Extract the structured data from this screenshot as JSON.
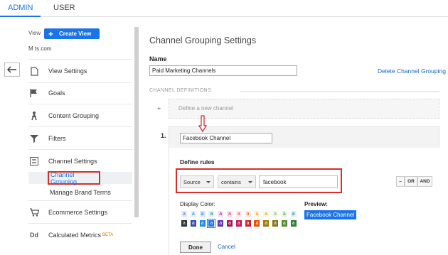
{
  "tabs": {
    "admin": "ADMIN",
    "user": "USER"
  },
  "left": {
    "view_label": "View",
    "create_view": "Create View",
    "view_name": "M            ts.com",
    "nav": {
      "view_settings": "View Settings",
      "goals": "Goals",
      "content_grouping": "Content Grouping",
      "filters": "Filters",
      "channel_settings": "Channel Settings",
      "ecommerce_settings": "Ecommerce Settings",
      "calculated_metrics": "Calculated Metrics",
      "beta": "BETA"
    },
    "sub": {
      "channel_grouping": "Channel Grouping",
      "manage_brand_terms": "Manage Brand Terms"
    }
  },
  "main": {
    "title": "Channel Grouping Settings",
    "name_label": "Name",
    "name_value": "Paid Marketing Channels",
    "delete_link": "Delete Channel Grouping",
    "channel_definitions": "CHANNEL DEFINITIONS",
    "define_new": "Define a new channel",
    "plus": "+",
    "rule_number": "1.",
    "channel_name": "Facebook Channel",
    "define_rules": "Define rules",
    "dimension": "Source",
    "operator": "contains",
    "value": "facebook",
    "logic": {
      "minus": "–",
      "or": "OR",
      "and": "AND"
    },
    "display_color": "Display Color:",
    "preview_label": "Preview:",
    "preview_text": "Facebook Channel",
    "done": "Done",
    "cancel": "Cancel"
  },
  "colors": {
    "accent": "#1a73e8",
    "highlight_border": "#d32f2f",
    "swatch_row1_bg": [
      "#e8eaf6",
      "#e3f2fd",
      "#d7e8ff",
      "#e0f2f1",
      "#f3e5f5",
      "#fce4ec",
      "#ffebee",
      "#fbe9e7",
      "#fff3e0",
      "#fff8e1",
      "#f1f8e9",
      "#e8f5e9",
      "#e0f2f1"
    ],
    "swatch_row1_fg": [
      "#5c6bc0",
      "#1e88e5",
      "#1a73e8",
      "#00897b",
      "#8e24aa",
      "#d81b60",
      "#e53935",
      "#f4511e",
      "#fb8c00",
      "#c0a000",
      "#7cb342",
      "#43a047",
      "#00897b"
    ],
    "swatch_row2_bg": [
      "#263238",
      "#3949ab",
      "#1e88e5",
      "#1a73e8",
      "#5e35b1",
      "#ad1457",
      "#c2185b",
      "#c62828",
      "#e65100",
      "#9e7b00",
      "#827717",
      "#558b2f",
      "#2e7d32"
    ]
  },
  "swatch_glyph": "a"
}
